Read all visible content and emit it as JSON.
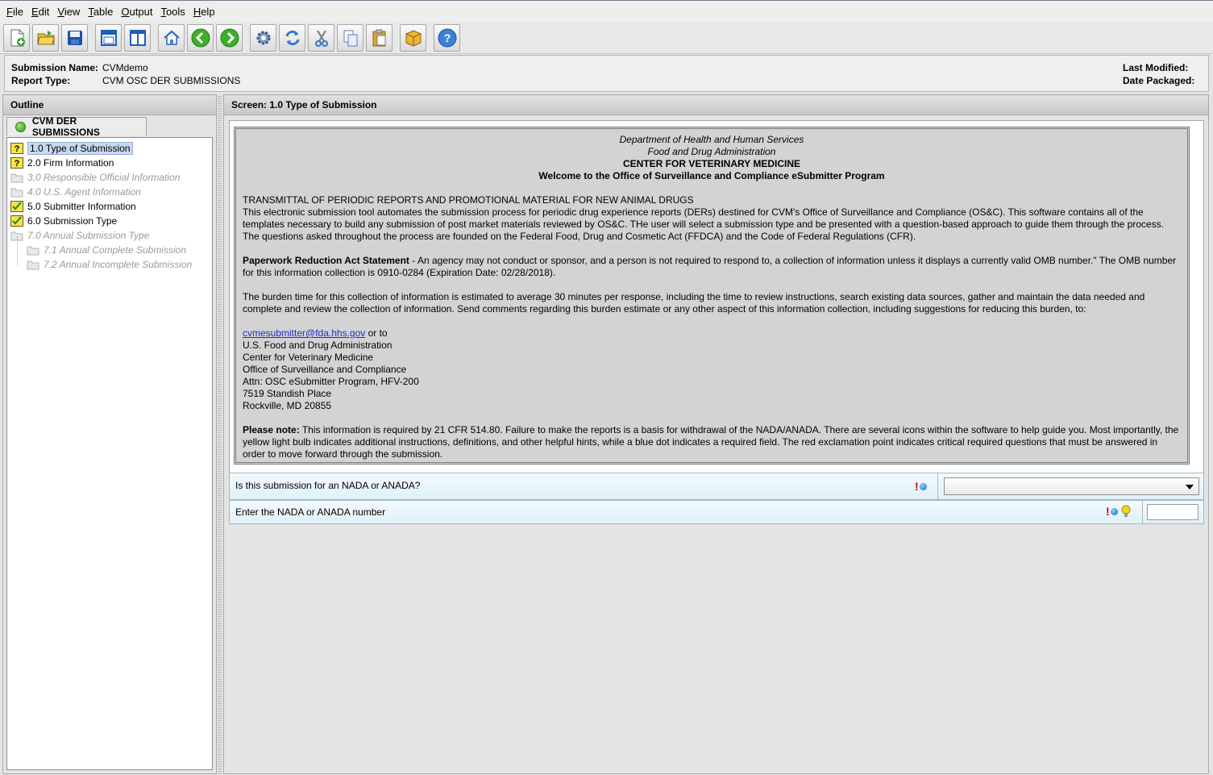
{
  "menu": [
    {
      "mnemonic": "F",
      "rest": "ile"
    },
    {
      "mnemonic": "E",
      "rest": "dit"
    },
    {
      "mnemonic": "V",
      "rest": "iew"
    },
    {
      "mnemonic": "T",
      "rest": "able"
    },
    {
      "mnemonic": "O",
      "rest": "utput"
    },
    {
      "mnemonic": "T",
      "rest": "ools"
    },
    {
      "mnemonic": "H",
      "rest": "elp"
    }
  ],
  "toolbar_icons": [
    "new-document-icon",
    "open-folder-icon",
    "save-disk-icon",
    "single-window-icon",
    "split-window-icon",
    "home-icon",
    "back-arrow-icon",
    "forward-arrow-icon",
    "settings-gear-icon",
    "refresh-icon",
    "cut-scissors-icon",
    "copy-icon",
    "paste-icon",
    "package-icon",
    "help-icon"
  ],
  "header": {
    "submission_name_label": "Submission Name:",
    "submission_name": "CVMdemo",
    "report_type_label": "Report Type:",
    "report_type": "CVM OSC DER SUBMISSIONS",
    "last_modified_label": "Last Modified:",
    "date_packaged_label": "Date Packaged:"
  },
  "outline": {
    "title": "Outline",
    "tab_label": "CVM DER SUBMISSIONS",
    "items": [
      {
        "label": "1.0 Type of Submission",
        "status": "question",
        "selected": true,
        "enabled": true
      },
      {
        "label": "2.0 Firm Information",
        "status": "question",
        "enabled": true
      },
      {
        "label": "3.0 Responsible Official Information",
        "status": "folder",
        "enabled": false
      },
      {
        "label": "4.0 U.S. Agent Information",
        "status": "folder",
        "enabled": false
      },
      {
        "label": "5.0 Submitter Information",
        "status": "check",
        "enabled": true
      },
      {
        "label": "6.0 Submission Type",
        "status": "check",
        "enabled": true
      },
      {
        "label": "7.0 Annual Submission Type",
        "status": "folder",
        "enabled": false
      },
      {
        "label": "7.1 Annual Complete Submission",
        "status": "folder",
        "enabled": false
      },
      {
        "label": "7.2 Annual Incomplete Submission",
        "status": "folder",
        "enabled": false
      }
    ]
  },
  "screen": {
    "title": "Screen: 1.0 Type of Submission",
    "intro": {
      "dept": "Department of Health and Human Services",
      "agency": "Food and Drug Administration",
      "center": "CENTER FOR VETERINARY MEDICINE",
      "welcome": "Welcome to the Office of Surveillance and Compliance eSubmitter Program",
      "transmittal_title": "TRANSMITTAL OF PERIODIC REPORTS AND PROMOTIONAL MATERIAL FOR NEW ANIMAL DRUGS",
      "transmittal_body": "This electronic submission tool automates the submission process for periodic drug experience reports (DERs) destined for CVM's Office of Surveillance and Compliance (OS&C). This software contains all of the templates necessary to build any submission of post market materials reviewed by OS&C. THe user will select a submission type and be presented with a question-based approach to guide them through the process. The questions asked throughout the process are founded on the Federal Food, Drug and Cosmetic Act (FFDCA) and the Code of Federal Regulations (CFR).",
      "paperwork_label": "Paperwork Reduction Act Statement",
      "paperwork_body": " - An agency may not conduct or sponsor, and a person is not required to respond to, a collection of information unless it displays a currently valid OMB number.\" The OMB number for this information collection is 0910-0284 (Expiration Date: 02/28/2018).",
      "burden": "The burden time for this collection of information is estimated to average 30 minutes per response, including the time to review instructions, search existing data sources, gather and maintain the data needed and complete and review the collection of information. Send comments regarding this burden estimate or any other aspect of this information collection, including suggestions for reducing this burden, to:",
      "email": "cvmesubmitter@fda.hhs.gov",
      "or_to": " or to",
      "address": [
        "U.S. Food and Drug Administration",
        "Center for Veterinary Medicine",
        "Office of Surveillance and Compliance",
        "Attn: OSC eSubmitter Program, HFV-200",
        "7519 Standish Place",
        "Rockville, MD 20855"
      ],
      "note_label": "Please note:",
      "note_body": " This information is required by 21 CFR 514.80. Failure to make the reports is a basis for withdrawal of the NADA/ANADA. There are several icons within the software to help guide you. Most importantly, the yellow light bulb indicates additional instructions, definitions, and other helpful hints, while a blue dot indicates a required field. The red exclamation point indicates critical required questions that must be answered in order to move forward through the submission."
    },
    "questions": [
      {
        "label": "Is this submission for an NADA or ANADA?",
        "value": "",
        "critical_mark": "!"
      },
      {
        "label": "Enter the NADA or ANADA number",
        "value": "",
        "critical_mark": "!"
      }
    ]
  }
}
